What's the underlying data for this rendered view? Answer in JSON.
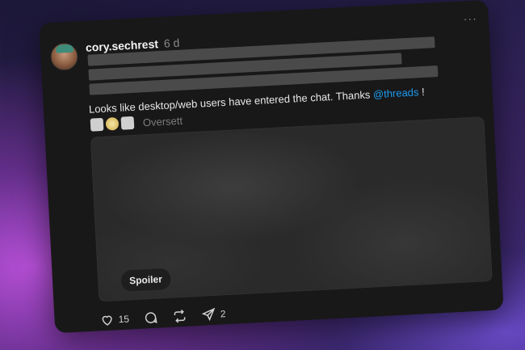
{
  "post": {
    "username": "cory.sechrest",
    "timestamp": "6 d",
    "more_label": "···",
    "text_before": "Looks like desktop/web users have entered the chat. Thanks ",
    "mention": "@threads",
    "text_after": " !",
    "translate_label": "Oversett",
    "spoiler_label": "Spoiler"
  },
  "actions": {
    "likes": "15",
    "shares": "2"
  },
  "colors": {
    "card_bg": "#181818",
    "mention": "#1d9bf0",
    "redaction": "#4a4a4a"
  },
  "icons": [
    "heart-icon",
    "comment-icon",
    "repost-icon",
    "share-icon"
  ]
}
